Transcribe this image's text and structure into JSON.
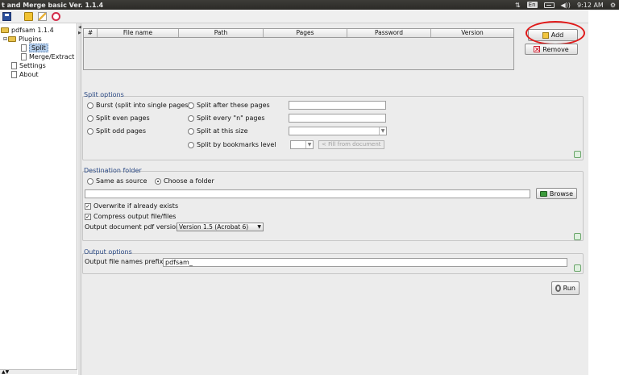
{
  "window": {
    "title": "t and Merge basic Ver. 1.1.4"
  },
  "system_tray": {
    "keyboard_layout": "En",
    "clock": "9:12 AM"
  },
  "sidebar": {
    "root": "pdfsam 1.1.4",
    "plugins": "Plugins",
    "items": [
      {
        "label": "Split",
        "selected": true
      },
      {
        "label": "Merge/Extract",
        "selected": false
      }
    ],
    "settings": "Settings",
    "about": "About"
  },
  "file_table": {
    "columns": [
      "#",
      "File name",
      "Path",
      "Pages",
      "Password",
      "Version"
    ]
  },
  "buttons": {
    "add": "Add",
    "remove": "Remove",
    "browse": "Browse",
    "run": "Run"
  },
  "split_options": {
    "title": "Split options",
    "burst": "Burst (split into single pages)",
    "even": "Split even pages",
    "odd": "Split odd pages",
    "after": "Split after these pages",
    "every_n": "Split every \"n\" pages",
    "size": "Split at this size",
    "bookmarks": "Split by bookmarks level",
    "fill_from_document": "< Fill from document",
    "after_value": "",
    "every_n_value": ""
  },
  "destination": {
    "title": "Destination folder",
    "same_as_source": "Same as source",
    "choose_folder": "Choose a folder",
    "selected": "choose_folder",
    "path_value": "",
    "overwrite": "Overwrite if already exists",
    "overwrite_checked": true,
    "compress": "Compress output file/files",
    "compress_checked": true,
    "version_label": "Output document pdf version:",
    "version_value": "Version 1.5 (Acrobat 6)"
  },
  "output_options": {
    "title": "Output options",
    "prefix_label": "Output file names prefix:",
    "prefix_value": "pdfsam_"
  },
  "colors": {
    "accent_title": "#2b4a86",
    "highlight_ring": "#e01a1a",
    "selection": "#b4cdea"
  }
}
